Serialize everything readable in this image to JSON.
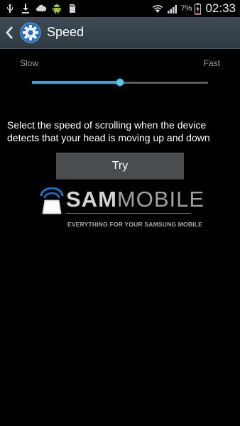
{
  "status_bar": {
    "battery_percent": "7%",
    "time": "02:33",
    "icons": [
      "usb-icon",
      "download-icon",
      "cloud-icon",
      "android-icon",
      "sd-card-icon",
      "wifi-icon",
      "signal-icon",
      "battery-charging-icon"
    ]
  },
  "action_bar": {
    "back_icon": "chevron-left-icon",
    "icon": "gear-icon",
    "title": "Speed"
  },
  "slider": {
    "min_label": "Slow",
    "max_label": "Fast",
    "value": 0.5,
    "accent_color": "#2fa8d8"
  },
  "description": "Select the speed of scrolling when the device detects that your head is moving up and down",
  "try_button": {
    "label": "Try"
  },
  "watermark": {
    "brand_bold": "SAM",
    "brand_light": "MOBILE",
    "tagline": "EVERYTHING FOR YOUR SAMSUNG MOBILE"
  }
}
